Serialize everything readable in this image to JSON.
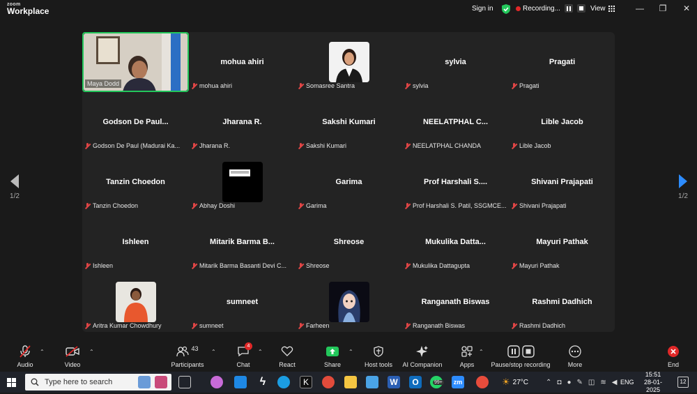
{
  "app": {
    "brand_top": "zoom",
    "brand_bottom": "Workplace"
  },
  "topbar": {
    "signin": "Sign in",
    "recording": "Recording...",
    "view": "View",
    "min": "—",
    "restore": "❐",
    "close": "✕"
  },
  "gallery": {
    "page_left": "1/2",
    "page_right": "1/2",
    "tiles": [
      {
        "name": "Maya Dodd",
        "center": ""
      },
      {
        "name": "mohua ahiri",
        "center": "mohua ahiri"
      },
      {
        "name": "Somasree Santra",
        "center": ""
      },
      {
        "name": "sylvia",
        "center": "sylvia"
      },
      {
        "name": "Pragati",
        "center": "Pragati"
      },
      {
        "name": "Godson De Paul (Madurai Ka...",
        "center": "Godson De Paul..."
      },
      {
        "name": "Jharana R.",
        "center": "Jharana R."
      },
      {
        "name": "Sakshi Kumari",
        "center": "Sakshi Kumari"
      },
      {
        "name": "NEELATPHAL CHANDA",
        "center": "NEELATPHAL C..."
      },
      {
        "name": "Lible Jacob",
        "center": "Lible Jacob"
      },
      {
        "name": "Tanzin Choedon",
        "center": "Tanzin Choedon"
      },
      {
        "name": "Abhay Doshi",
        "center": ""
      },
      {
        "name": "Garima",
        "center": "Garima"
      },
      {
        "name": "Prof Harshali S. Patil, SSGMCE...",
        "center": "Prof Harshali S...."
      },
      {
        "name": "Shivani Prajapati",
        "center": "Shivani Prajapati"
      },
      {
        "name": "Ishleen",
        "center": "Ishleen"
      },
      {
        "name": "Mitarik Barma Basanti Devi C...",
        "center": "Mitarik Barma B..."
      },
      {
        "name": "Shreose",
        "center": "Shreose"
      },
      {
        "name": "Mukulika Dattagupta",
        "center": "Mukulika Datta..."
      },
      {
        "name": "Mayuri Pathak",
        "center": "Mayuri Pathak"
      },
      {
        "name": "Aritra Kumar Chowdhury",
        "center": ""
      },
      {
        "name": "sumneet",
        "center": "sumneet"
      },
      {
        "name": "Farheen",
        "center": ""
      },
      {
        "name": "Ranganath Biswas",
        "center": "Ranganath Biswas"
      },
      {
        "name": "Rashmi Dadhich",
        "center": "Rashmi Dadhich"
      }
    ]
  },
  "toolbar": {
    "audio": "Audio",
    "video": "Video",
    "participants": "Participants",
    "participants_count": "43",
    "chat": "Chat",
    "chat_badge": "4",
    "react": "React",
    "share": "Share",
    "host_tools": "Host tools",
    "ai_companion": "AI Companion",
    "apps": "Apps",
    "pause_recording": "Pause/stop recording",
    "more": "More",
    "end": "End"
  },
  "taskbar": {
    "search_placeholder": "Type here to search",
    "weather": "27°C",
    "lang": "ENG",
    "time": "15:51",
    "date": "28-01-2025",
    "notifications": "12",
    "badge_99": "99+"
  },
  "colors": {
    "active_speaker": "#23c75b",
    "share_green": "#23c75b",
    "end_red": "#e02828",
    "muted_red": "#e04545"
  }
}
